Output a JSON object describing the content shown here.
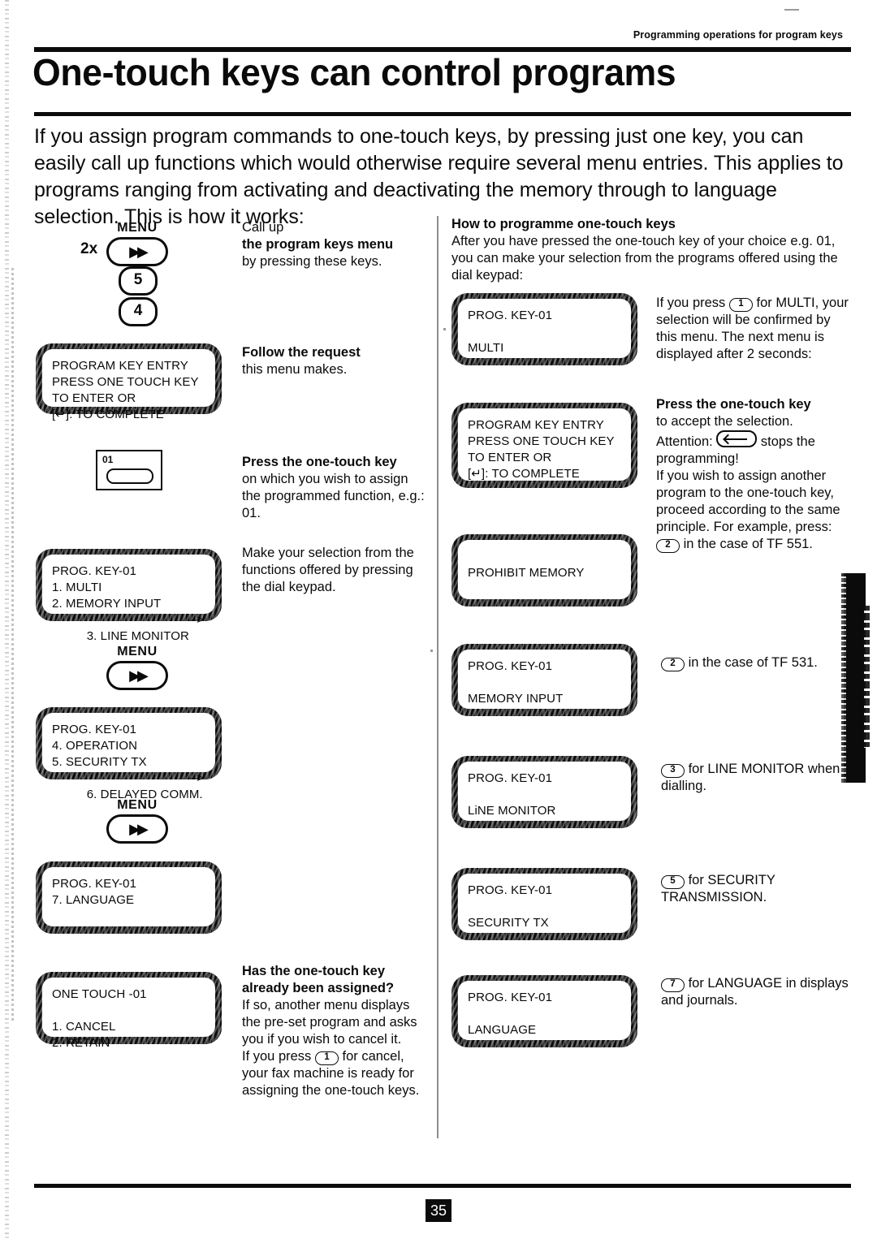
{
  "header": {
    "kicker": "Programming operations for program keys",
    "title": "One-touch keys can control programs",
    "intro": "If you assign program commands to one-touch keys, by pressing just one key, you can easily call up functions which would otherwise require several menu entries. This applies to programs ranging from activating and deactivating the memory through to language selection. This is how it works:"
  },
  "keys": {
    "menu_label": "MENU",
    "menu_glyph": "▶▶",
    "repeat_2x": "2x",
    "digit_5": "5",
    "digit_4": "4",
    "one_touch_number": "01"
  },
  "left_column": {
    "lcd_program_key_entry": {
      "line1": "PROGRAM KEY ENTRY",
      "line2": "PRESS ONE TOUCH KEY",
      "line3": "TO ENTER OR",
      "line4": "[↵]: TO COMPLETE"
    },
    "lcd_menu_1": {
      "line1": "PROG. KEY-01",
      "line2": "1. MULTI",
      "line3": "2. MEMORY INPUT",
      "line4": "3. LINE MONITOR",
      "arrow": "–>"
    },
    "lcd_menu_2": {
      "line1": "PROG. KEY-01",
      "line2": "4. OPERATION",
      "line3": "5. SECURITY TX",
      "line4": "6. DELAYED COMM.",
      "arrow": "–>"
    },
    "lcd_menu_3": {
      "line1": "PROG. KEY-01",
      "line2": "7. LANGUAGE"
    },
    "lcd_one_touch": {
      "line1": "ONE TOUCH -01",
      "line2": "1. CANCEL",
      "line3": "2. RETAIN"
    }
  },
  "middle_column": {
    "step1": {
      "pre": "Call up",
      "heading": "the program keys menu",
      "post": "by pressing these keys."
    },
    "step2": {
      "heading": "Follow the request",
      "post": "this menu makes."
    },
    "step3": {
      "heading": "Press the one-touch key",
      "post": "on which you wish to assign the programmed function, e.g.: 01."
    },
    "step4": {
      "post": "Make your selection from the functions offered by pressing the dial keypad."
    },
    "step5": {
      "heading": "Has the one-touch key already been assigned?",
      "post_a": "If so, another menu displays the pre-set program and asks you if you wish to cancel it.",
      "post_b_pre": "If you press",
      "post_b_key": "1",
      "post_b_post": "for cancel, your fax machine is ready for assigning the one-touch keys."
    }
  },
  "right_column": {
    "heading": "How to programme one-touch keys",
    "intro": "After you have pressed the one-touch key of your choice e.g. 01, you can make your selection from the programs offered using the dial keypad:",
    "lcd_multi": {
      "line1": "PROG. KEY-01",
      "line2": "MULTI"
    },
    "note_multi": {
      "pre": "If you press",
      "key": "1",
      "post": "for MULTI, your selection will be confirmed by this menu.  The next menu is displayed after 2 seconds:"
    },
    "lcd_program_key_entry": {
      "line1": "PROGRAM KEY ENTRY",
      "line2": "PRESS ONE TOUCH KEY",
      "line3": "TO ENTER OR",
      "line4": "[↵]: TO COMPLETE"
    },
    "note_press": {
      "heading": "Press the one-touch key",
      "l1": "to accept the selection.",
      "l2_pre": "Attention:",
      "l2_key": "stop-key",
      "l2_post": "stops the programming!",
      "l3": "If you wish to assign another program to the one-touch key, proceed according to the same principle. For example, press:",
      "l4_key": "2",
      "l4_post": "in the case of TF 551."
    },
    "lcd_prohibit_memory": {
      "line1": "PROHIBIT MEMORY"
    },
    "note_tf531": {
      "key": "2",
      "post": "in the case of TF 531."
    },
    "lcd_memory_input": {
      "line1": "PROG. KEY-01",
      "line2": "MEMORY INPUT"
    },
    "lcd_line_monitor": {
      "line1": "PROG. KEY-01",
      "line2": "LiNE MONITOR"
    },
    "note_line_monitor": {
      "key": "3",
      "post": "for LINE MONITOR when dialling."
    },
    "lcd_security_tx": {
      "line1": "PROG. KEY-01",
      "line2": "SECURITY TX"
    },
    "note_security": {
      "key": "5",
      "post": "for SECURITY TRANSMISSION."
    },
    "lcd_language": {
      "line1": "PROG. KEY-01",
      "line2": "LANGUAGE"
    },
    "note_language": {
      "key": "7",
      "post": "for LANGUAGE in displays and journals."
    }
  },
  "footer": {
    "page_number": "35"
  }
}
